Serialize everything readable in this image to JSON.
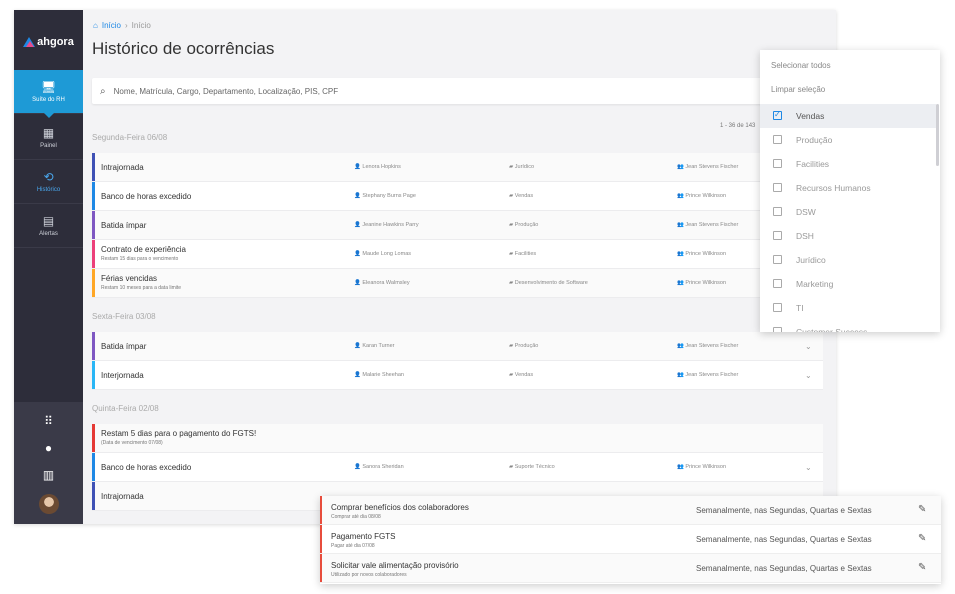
{
  "sidebar": {
    "logo": "ahgora",
    "items": [
      {
        "label": "Suíte do RH",
        "icon": "monitor-icon"
      },
      {
        "label": "Painel",
        "icon": "dashboard-icon"
      },
      {
        "label": "Histórico",
        "icon": "history-icon"
      },
      {
        "label": "Alertas",
        "icon": "document-icon"
      }
    ],
    "bottom_icons": [
      "apps-grid-icon",
      "help-icon",
      "building-icon",
      "user-avatar"
    ]
  },
  "breadcrumb": {
    "home": "Início",
    "current": "Início"
  },
  "page_title": "Histórico de ocorrências",
  "search": {
    "placeholder": "Nome, Matrícula, Cargo, Departamento, Localização, PIS, CPF"
  },
  "pager": "1 - 36 de 143",
  "groups": [
    {
      "day": "Segunda-Feira 06/08",
      "rows": [
        {
          "title": "Intrajornada",
          "sub": "",
          "color": "#3f51b5",
          "person": "Lenora Hopkins",
          "dept": "Jurídico",
          "manager": "Jean Stevens Fischer"
        },
        {
          "title": "Banco de horas excedido",
          "sub": "",
          "color": "#1e88e5",
          "person": "Stephany Burns Page",
          "dept": "Vendas",
          "manager": "Prince Wilkinson"
        },
        {
          "title": "Batida ímpar",
          "sub": "",
          "color": "#7e57c2",
          "person": "Jeanine Hawkins Parry",
          "dept": "Produção",
          "manager": "Jean Stevens Fischer"
        },
        {
          "title": "Contrato de experiência",
          "sub": "Restam 15 dias para o vencimento",
          "color": "#ec407a",
          "person": "Maude Long Lomas",
          "dept": "Facilities",
          "manager": "Prince Wilkinson"
        },
        {
          "title": "Férias vencidas",
          "sub": "Restam 10 meses para a data limite",
          "color": "#ffa726",
          "person": "Eleanora Walmsley",
          "dept": "Desenvolvimento de Software",
          "manager": "Prince Wilkinson"
        }
      ]
    },
    {
      "day": "Sexta-Feira 03/08",
      "rows": [
        {
          "title": "Batida ímpar",
          "sub": "",
          "color": "#7e57c2",
          "person": "Karan Turner",
          "dept": "Produção",
          "manager": "Jean Stevens Fischer"
        },
        {
          "title": "Interjornada",
          "sub": "",
          "color": "#29b6f6",
          "person": "Malarie Sheehan",
          "dept": "Vendas",
          "manager": "Jean Stevens Fischer"
        }
      ]
    },
    {
      "day": "Quinta-Feira 02/08",
      "rows": [
        {
          "title": "Restam 5 dias para o pagamento do FGTS!",
          "sub": "(Data de vencimento 07/08)",
          "color": "#e53935",
          "person": "",
          "dept": "",
          "manager": ""
        },
        {
          "title": "Banco de horas excedido",
          "sub": "",
          "color": "#1e88e5",
          "person": "Sanora Sheridan",
          "dept": "Suporte Técnico",
          "manager": "Prince Wilkinson"
        },
        {
          "title": "Intrajornada",
          "sub": "",
          "color": "#3f51b5",
          "person": "",
          "dept": "",
          "manager": ""
        }
      ]
    }
  ],
  "dropdown": {
    "select_all": "Selecionar todos",
    "clear": "Limpar seleção",
    "options": [
      {
        "label": "Vendas",
        "checked": true
      },
      {
        "label": "Produção",
        "checked": false
      },
      {
        "label": "Facilities",
        "checked": false
      },
      {
        "label": "Recursos Humanos",
        "checked": false
      },
      {
        "label": "DSW",
        "checked": false
      },
      {
        "label": "DSH",
        "checked": false
      },
      {
        "label": "Jurídico",
        "checked": false
      },
      {
        "label": "Marketing",
        "checked": false
      },
      {
        "label": "TI",
        "checked": false
      },
      {
        "label": "Customer Success",
        "checked": false
      }
    ]
  },
  "tasks": [
    {
      "title": "Comprar benefícios dos colaboradores",
      "sub": "Comprar até dia 08/08",
      "freq": "Semanalmente, nas Segundas, Quartas e Sextas"
    },
    {
      "title": "Pagamento FGTS",
      "sub": "Pagar até dia 07/08",
      "freq": "Semanalmente, nas Segundas, Quartas e Sextas"
    },
    {
      "title": "Solicitar vale alimentação provisório",
      "sub": "Utilizado por novos colaboradores",
      "freq": "Semanalmente, nas Segundas, Quartas e Sextas"
    }
  ]
}
